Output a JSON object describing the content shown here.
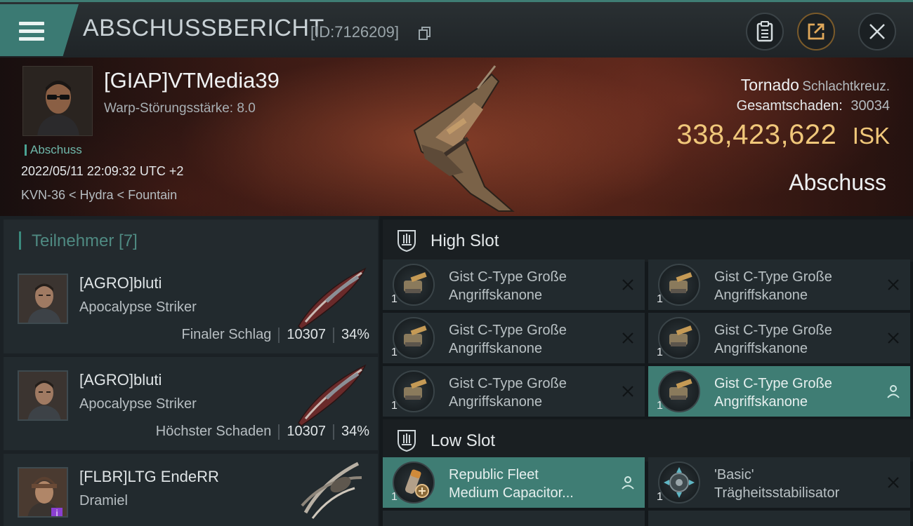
{
  "header": {
    "title": "ABSCHUSSBERICHT",
    "kill_id": "[ID:7126209]"
  },
  "victim": {
    "pilot_name": "[GIAP]VTMedia39",
    "warp_disruption": "Warp-Störungsstärke: 8.0",
    "tag": "Abschuss",
    "datetime": "2022/05/11 22:09:32 UTC +2",
    "location": "KVN-36 < Hydra < Fountain",
    "ship_name": "Tornado",
    "ship_class": "Schlachtkreuz.",
    "total_damage_label": "Gesamtschaden:",
    "total_damage_value": "30034",
    "isk_value": "338,423,622",
    "isk_unit": "ISK",
    "result": "Abschuss"
  },
  "attackers": {
    "title": "Teilnehmer [7]",
    "items": [
      {
        "name": "[AGRO]bluti",
        "ship": "Apocalypse Striker",
        "label": "Finaler Schlag",
        "damage": "10307",
        "percent": "34%"
      },
      {
        "name": "[AGRO]bluti",
        "ship": "Apocalypse Striker",
        "label": "Höchster Schaden",
        "damage": "10307",
        "percent": "34%"
      },
      {
        "name": "[FLBR]LTG EndeRR",
        "ship": "Dramiel"
      }
    ]
  },
  "fittings": {
    "high_slot_title": "High Slot",
    "low_slot_title": "Low Slot",
    "high": [
      {
        "qty": "1",
        "line1": "Gist C-Type Große",
        "line2": "Angriffskanone",
        "action": "destroyed"
      },
      {
        "qty": "1",
        "line1": "Gist C-Type Große",
        "line2": "Angriffskanone",
        "action": "destroyed"
      },
      {
        "qty": "1",
        "line1": "Gist C-Type Große",
        "line2": "Angriffskanone",
        "action": "destroyed"
      },
      {
        "qty": "1",
        "line1": "Gist C-Type Große",
        "line2": "Angriffskanone",
        "action": "destroyed"
      },
      {
        "qty": "1",
        "line1": "Gist C-Type Große",
        "line2": "Angriffskanone",
        "action": "destroyed"
      },
      {
        "qty": "1",
        "line1": "Gist C-Type Große",
        "line2": "Angriffskanone",
        "action": "dropped"
      }
    ],
    "low": [
      {
        "qty": "1",
        "line1": "Republic Fleet",
        "line2": "Medium Capacitor...",
        "action": "dropped"
      },
      {
        "qty": "1",
        "line1": "'Basic'",
        "line2": "Trägheitsstabilisator",
        "action": "destroyed"
      }
    ]
  },
  "colors": {
    "accent_teal": "#3f7d74",
    "isk_gold": "#f0c77a"
  }
}
